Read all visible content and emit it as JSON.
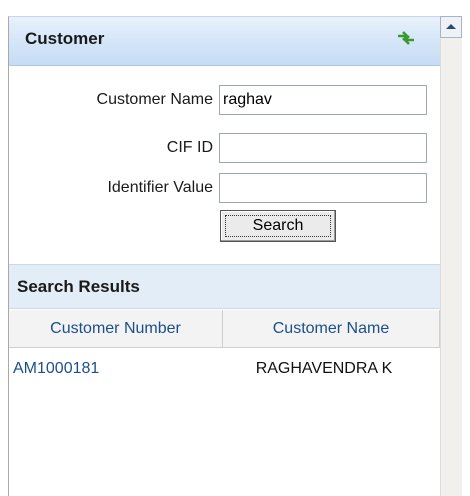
{
  "panel": {
    "title": "Customer"
  },
  "form": {
    "customer_name": {
      "label": "Customer Name",
      "value": "raghav"
    },
    "cif_id": {
      "label": "CIF ID",
      "value": ""
    },
    "identifier_value": {
      "label": "Identifier Value",
      "value": ""
    },
    "search_label": "Search"
  },
  "results": {
    "title": "Search Results",
    "columns": [
      "Customer Number",
      "Customer Name"
    ],
    "rows": [
      {
        "customer_number": "AM1000181",
        "customer_name": "RAGHAVENDRA K"
      }
    ]
  },
  "icons": {
    "refresh": "refresh-arrows-icon",
    "scroll_up": "scroll-up-arrow-icon"
  },
  "colors": {
    "header_bg": "#d5e6f8",
    "link": "#1b4f8a",
    "icon_green": "#3a9a2e"
  }
}
